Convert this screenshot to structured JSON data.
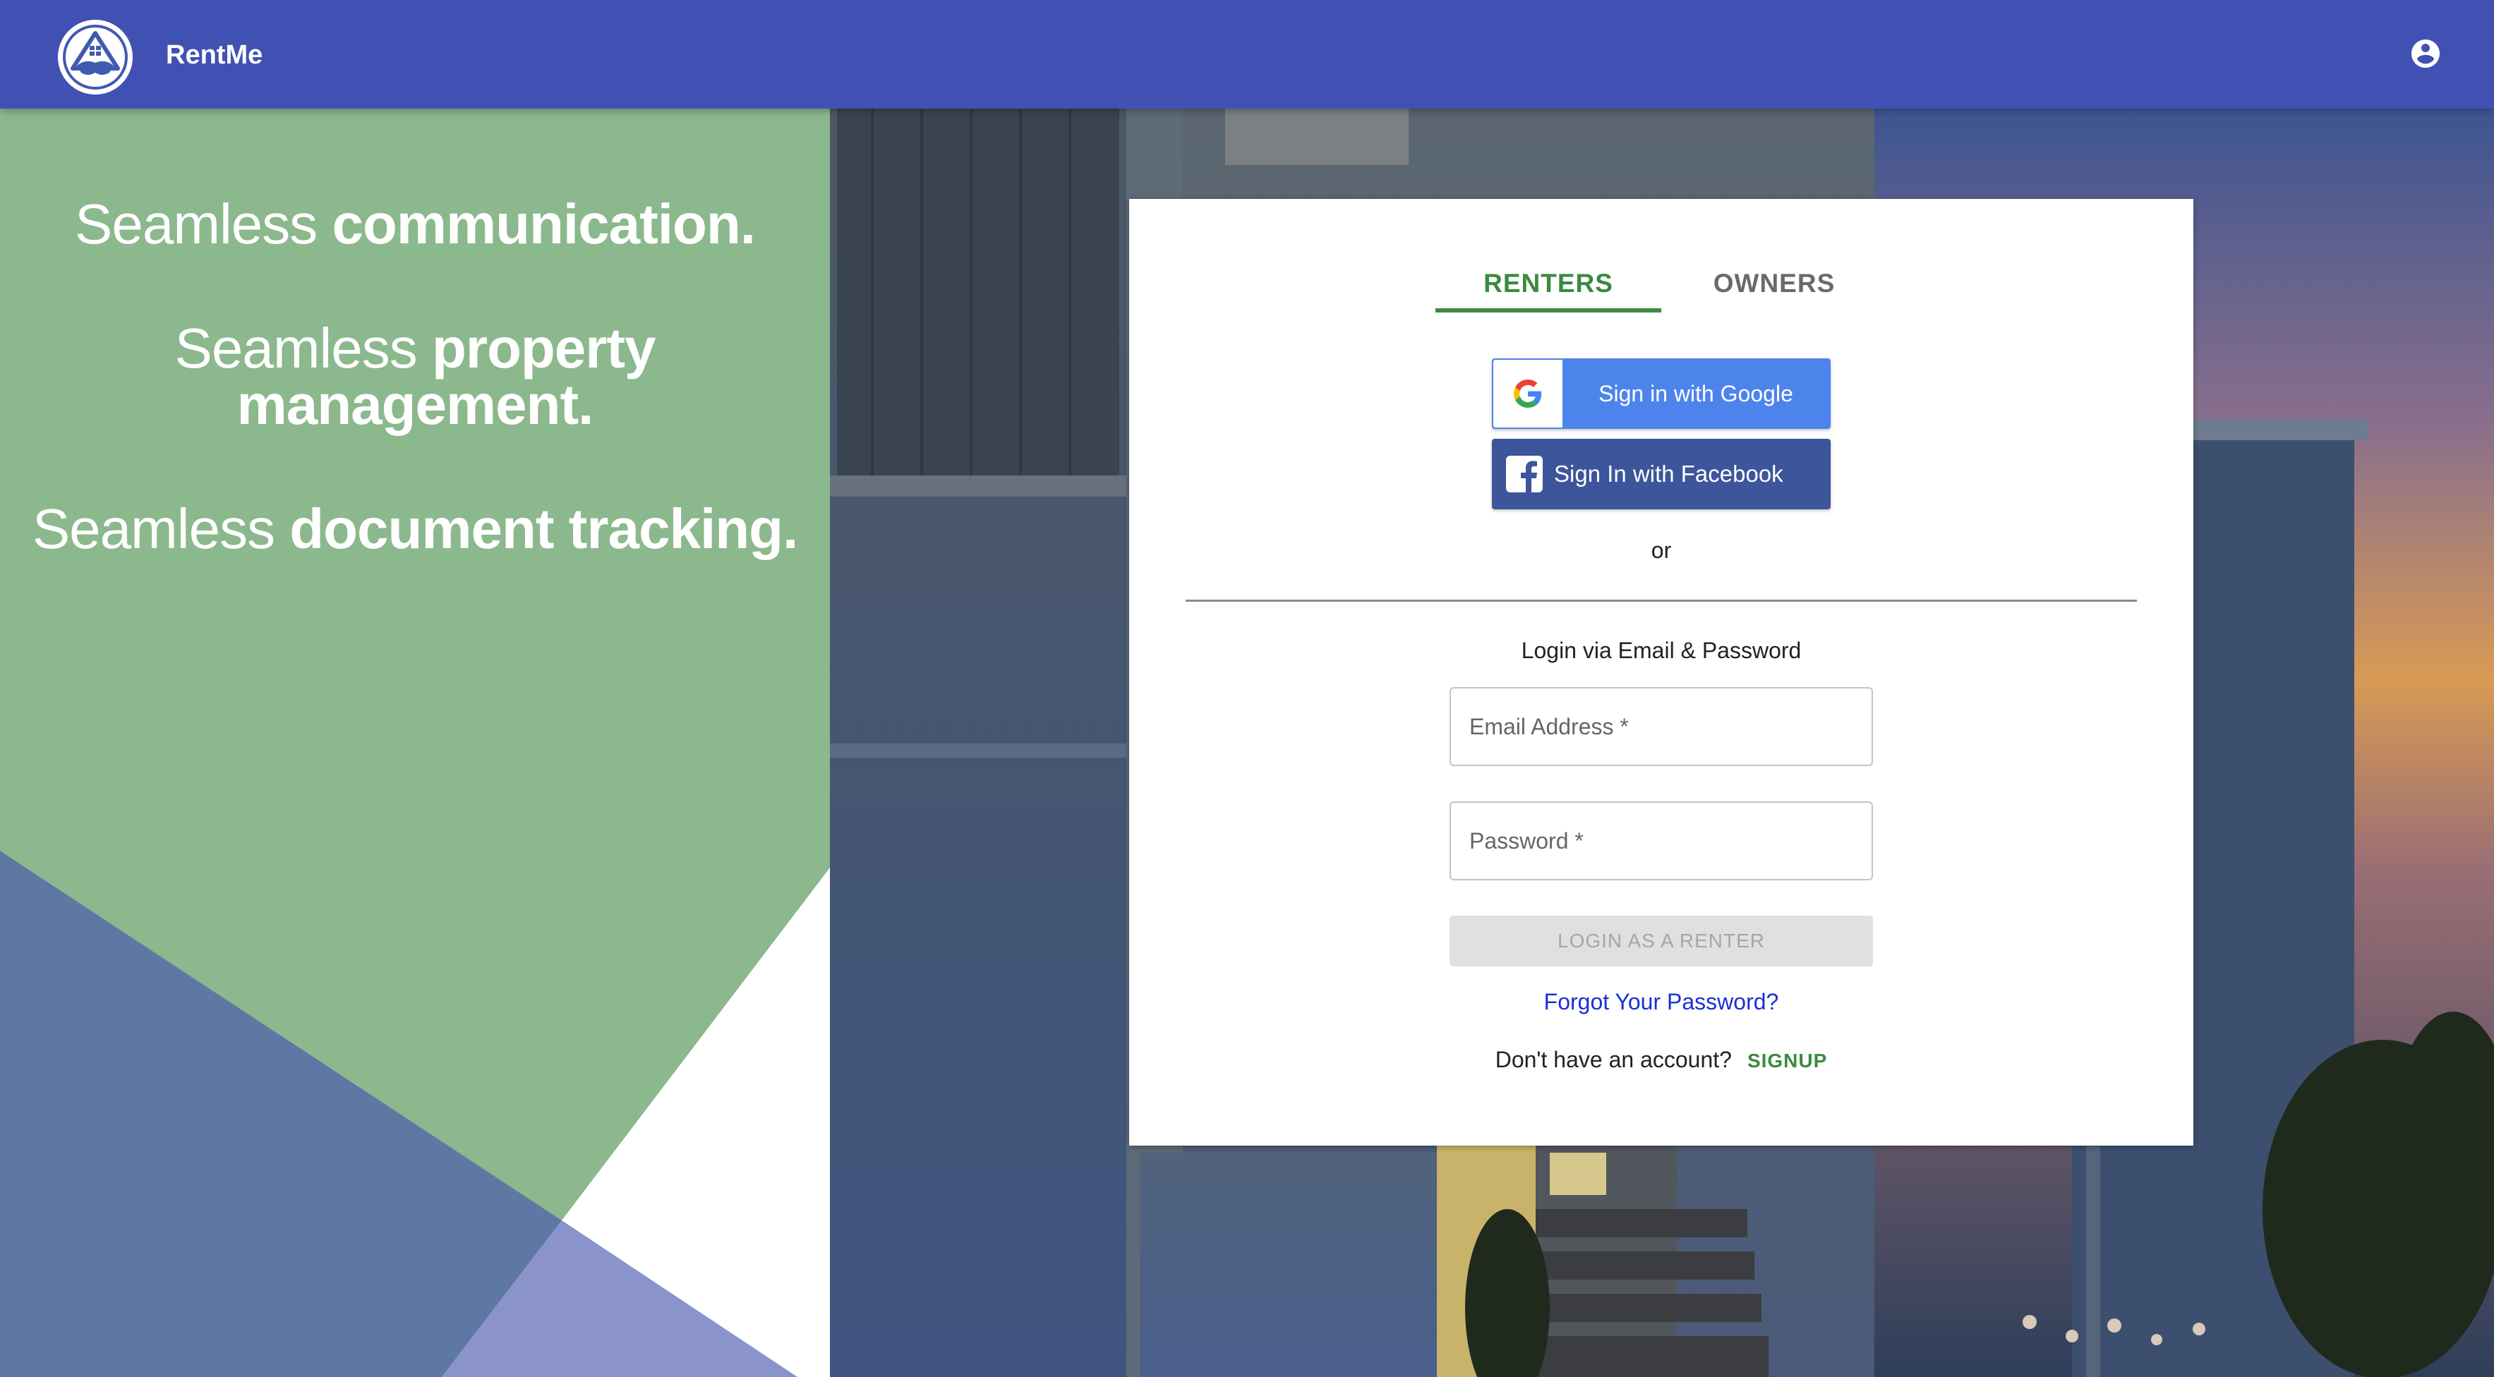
{
  "header": {
    "brand": "RentMe",
    "logo_icon": "handshake-house-logo",
    "account_icon": "account-circle-icon",
    "background_color": "#4151b3"
  },
  "promo": {
    "lines": [
      {
        "light": "Seamless ",
        "bold": "communication."
      },
      {
        "light": "Seamless ",
        "bold": "property",
        "bold2": "management."
      },
      {
        "light": "Seamless ",
        "bold": "document tracking."
      }
    ],
    "colors": {
      "green": "#8bb88d",
      "blue": "#5e77a3",
      "lavender": "#8a93cb"
    }
  },
  "login": {
    "tabs": [
      {
        "label": "RENTERS",
        "active": true
      },
      {
        "label": "OWNERS",
        "active": false
      }
    ],
    "google_label": "Sign in with Google",
    "facebook_label": "Sign In with Facebook",
    "or_text": "or",
    "heading": "Login via Email & Password",
    "email_placeholder": "Email Address *",
    "password_placeholder": "Password *",
    "submit_label": "LOGIN AS A RENTER",
    "forgot_label": "Forgot Your Password?",
    "no_account_text": "Don't have an account?",
    "signup_label": "SIGNUP",
    "accent_color": "#3b8a42",
    "google_color": "#4d84ec",
    "facebook_color": "#3c559b"
  }
}
